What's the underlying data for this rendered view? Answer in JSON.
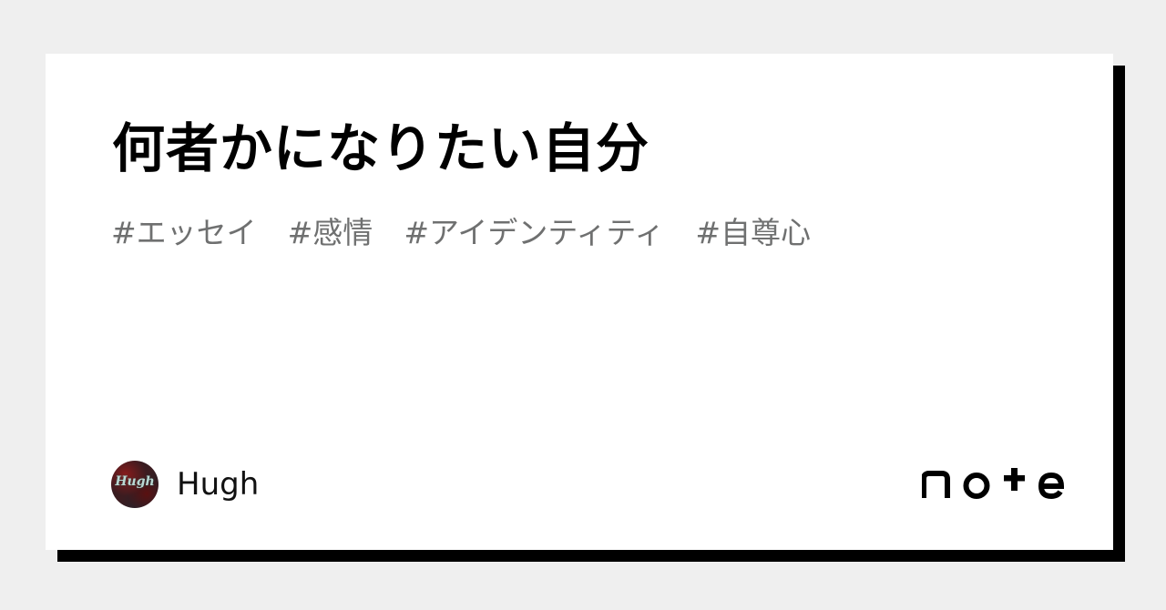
{
  "article": {
    "title": "何者かになりたい自分",
    "tags": [
      "#エッセイ",
      "#感情",
      "#アイデンティティ",
      "#自尊心"
    ]
  },
  "author": {
    "name": "Hugh",
    "avatar_text": "Hugh"
  },
  "brand": {
    "logo_text": "note"
  },
  "colors": {
    "background": "#efefef",
    "card": "#ffffff",
    "shadow": "#000000",
    "tag_text": "#6f7070"
  }
}
